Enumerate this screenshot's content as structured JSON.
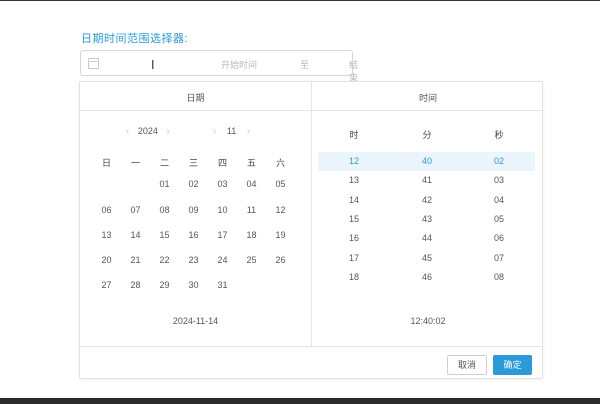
{
  "label": "日期时间范围选择器:",
  "input": {
    "start_placeholder": "开始时间",
    "separator": "至",
    "end_placeholder": "结束时间"
  },
  "popup": {
    "date_title": "日期",
    "time_title": "时间",
    "year": "2024",
    "month": "11",
    "weekdays": [
      "日",
      "一",
      "二",
      "三",
      "四",
      "五",
      "六"
    ],
    "weeks": [
      [
        "",
        "",
        "",
        "01",
        "02",
        "03",
        "04",
        "05"
      ],
      [
        "06",
        "07",
        "08",
        "09",
        "10",
        "11",
        "12"
      ],
      [
        "13",
        "14",
        "15",
        "16",
        "17",
        "18",
        "19"
      ],
      [
        "20",
        "21",
        "22",
        "23",
        "24",
        "25",
        "26"
      ],
      [
        "27",
        "28",
        "29",
        "30",
        "31",
        "",
        ""
      ]
    ],
    "selected_day": "14",
    "selected_date": "2024-11-14",
    "time_headers": [
      "时",
      "分",
      "秒"
    ],
    "hours": [
      "12",
      "13",
      "14",
      "15",
      "16",
      "17",
      "18"
    ],
    "minutes": [
      "40",
      "41",
      "42",
      "43",
      "44",
      "45",
      "46"
    ],
    "seconds": [
      "02",
      "03",
      "04",
      "05",
      "06",
      "07",
      "08"
    ],
    "selected_time": "12:40:02",
    "cancel_label": "取消",
    "ok_label": "确定"
  },
  "colors": {
    "accent": "#2a9bd8",
    "highlight": "#eaf5fc"
  },
  "icons": {
    "calendar": "calendar-icon",
    "cursor": "text-cursor-icon",
    "prev": "chevron-left-icon",
    "next": "chevron-right-icon"
  }
}
